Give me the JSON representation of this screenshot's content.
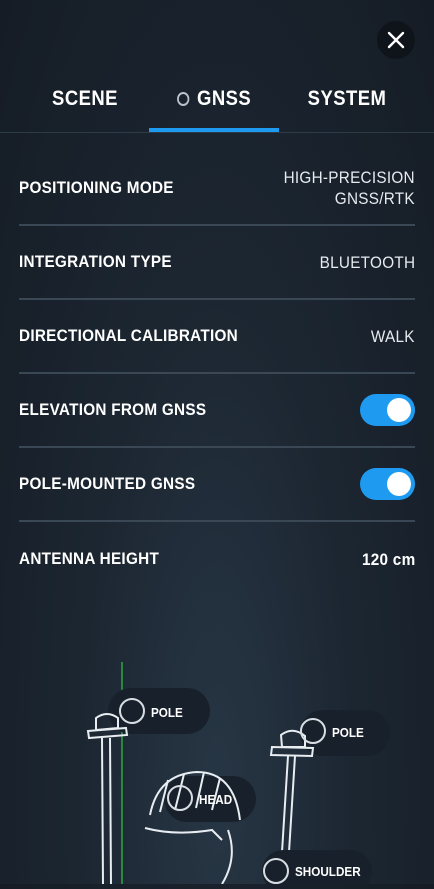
{
  "header": {
    "close_icon": "close-icon"
  },
  "tabs": [
    {
      "label": "SCENE",
      "active": false
    },
    {
      "label": "GNSS",
      "active": true,
      "status_icon": "status-ring-icon"
    },
    {
      "label": "SYSTEM",
      "active": false
    }
  ],
  "settings": {
    "positioning_mode": {
      "label": "POSITIONING MODE",
      "value": "HIGH-PRECISION\nGNSS/RTK"
    },
    "integration_type": {
      "label": "INTEGRATION TYPE",
      "value": "BLUETOOTH"
    },
    "directional_calibration": {
      "label": "DIRECTIONAL CALIBRATION",
      "value": "WALK"
    },
    "elevation_from_gnss": {
      "label": "ELEVATION FROM GNSS",
      "enabled": true
    },
    "pole_mounted_gnss": {
      "label": "POLE-MOUNTED GNSS",
      "enabled": true
    },
    "antenna_height": {
      "label": "ANTENNA HEIGHT",
      "value": "120 cm"
    }
  },
  "illustration": {
    "labels": {
      "pole_left": "POLE",
      "pole_right": "POLE",
      "head": "HEAD",
      "shoulder": "SHOULDER"
    }
  },
  "colors": {
    "accent": "#1e9bf0",
    "background": "#1c2631",
    "divider": "#3a4754"
  }
}
